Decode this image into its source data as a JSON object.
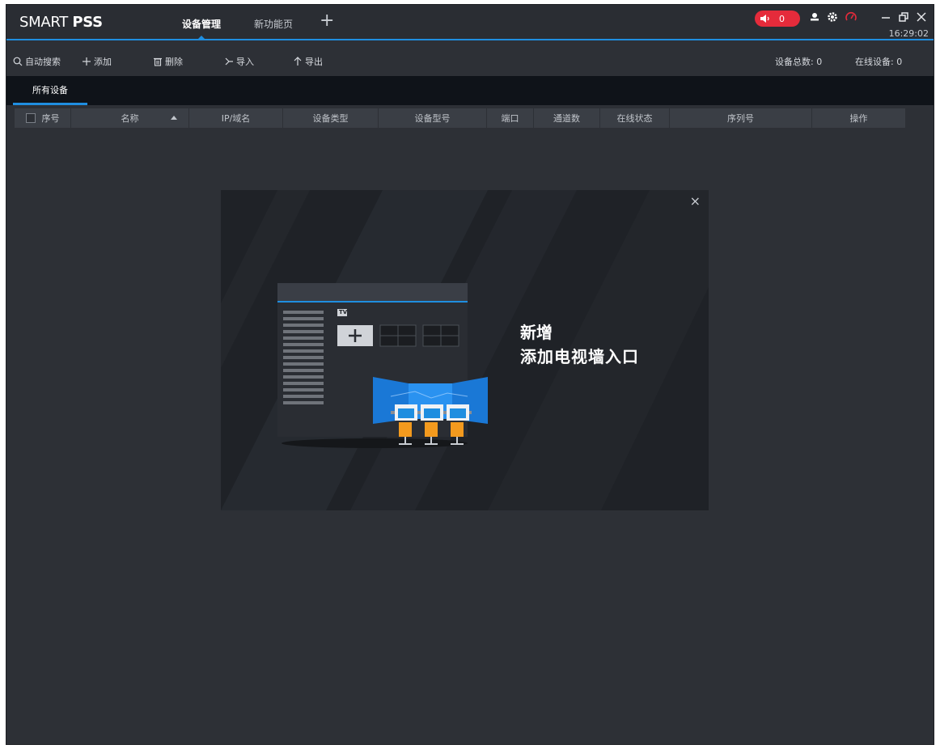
{
  "app": {
    "logo_light": "SMART ",
    "logo_bold": "PSS",
    "tabs": [
      {
        "label": "设备管理",
        "active": true
      },
      {
        "label": "新功能页",
        "active": false
      }
    ],
    "add_tab_glyph": "+",
    "alarm_count": "0",
    "clock": "16:29:02",
    "accent_color": "#1f8ee0",
    "alarm_color": "#e52b3b"
  },
  "toolbar": {
    "auto_search": "自动搜索",
    "add": "添加",
    "delete": "删除",
    "import": "导入",
    "export": "导出",
    "total_label": "设备总数: 0",
    "online_label": "在线设备: 0"
  },
  "subtabs": {
    "all_devices": "所有设备"
  },
  "table": {
    "columns": [
      "序号",
      "名称",
      "IP/域名",
      "设备类型",
      "设备型号",
      "端口",
      "通道数",
      "在线状态",
      "序列号",
      "操作"
    ],
    "rows": []
  },
  "popup": {
    "close": "×",
    "line1": "新增",
    "line2": "添加电视墙入口",
    "tv_label": "TV",
    "plus": "+"
  }
}
